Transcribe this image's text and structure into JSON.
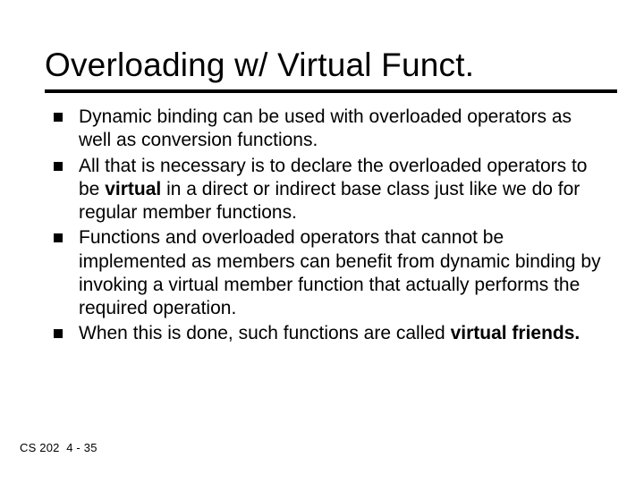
{
  "title": "Overloading w/ Virtual Funct.",
  "bullets": [
    {
      "pre": "Dynamic binding can be used with overloaded operators as well as conversion functions.",
      "bold": "",
      "post": ""
    },
    {
      "pre": "All that is necessary is to declare the overloaded operators to be ",
      "bold": "virtual",
      "post": " in a direct or indirect base class just like we do for regular member functions."
    },
    {
      "pre": "Functions and overloaded operators that cannot be implemented as members can benefit from dynamic binding by invoking a virtual member function that actually performs the required operation.",
      "bold": "",
      "post": ""
    },
    {
      "pre": "When this is done, such functions are called ",
      "bold": "virtual friends.",
      "post": ""
    }
  ],
  "footer": {
    "course": "CS 202",
    "page": "4 - 35"
  }
}
